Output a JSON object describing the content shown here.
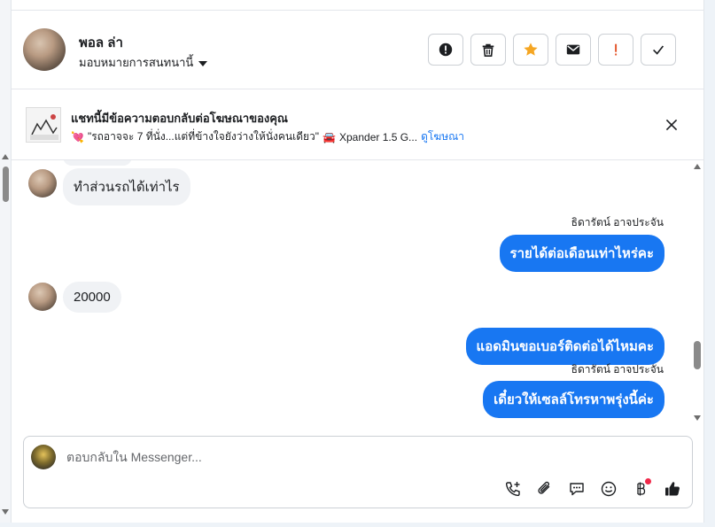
{
  "colors": {
    "accent": "#1877f2",
    "bubble_in": "#f0f2f5",
    "alert_red": "#f02849",
    "star_orange": "#f5a623"
  },
  "header": {
    "name": "พอล ล่า",
    "assign_label": "มอบหมายการสนทนานี้",
    "actions": [
      {
        "icon": "exclamation-circle-icon"
      },
      {
        "icon": "trash-icon"
      },
      {
        "icon": "star-icon"
      },
      {
        "icon": "envelope-icon"
      },
      {
        "icon": "exclamation-icon"
      },
      {
        "icon": "check-icon"
      }
    ]
  },
  "banner": {
    "title": "แชทนี้มีข้อความตอบกลับต่อโฆษณาของคุณ",
    "quote": "\"รถอาจจะ 7 ที่นั่ง...แต่ที่ข้างใจยังว่างให้นั่งคนเดียว\"",
    "product": "Xpander 1.5 G...",
    "view_ad_link": "ดูโฆษณา"
  },
  "messages": [
    {
      "direction": "in",
      "text": "ทำส่วนรถได้เท่าไร"
    },
    {
      "direction": "out",
      "sender": "ธิดารัตน์ อาจประจัน",
      "text": "รายได้ต่อเดือนเท่าไหร่คะ"
    },
    {
      "direction": "in",
      "text": "20000"
    },
    {
      "direction": "out",
      "text": "แอดมินขอเบอร์ติดต่อได้ไหมคะ"
    },
    {
      "direction": "out",
      "sender": "ธิดารัตน์ อาจประจัน",
      "text": "เดี๋ยวให้เซลล์โทรหาพรุ่งนี้ค่ะ"
    }
  ],
  "composer": {
    "placeholder": "ตอบกลับใน Messenger...",
    "tools": [
      "call-add-icon",
      "paperclip-icon",
      "chat-bubble-icon",
      "emoji-icon",
      "baht-icon",
      "thumbs-up-icon"
    ]
  }
}
